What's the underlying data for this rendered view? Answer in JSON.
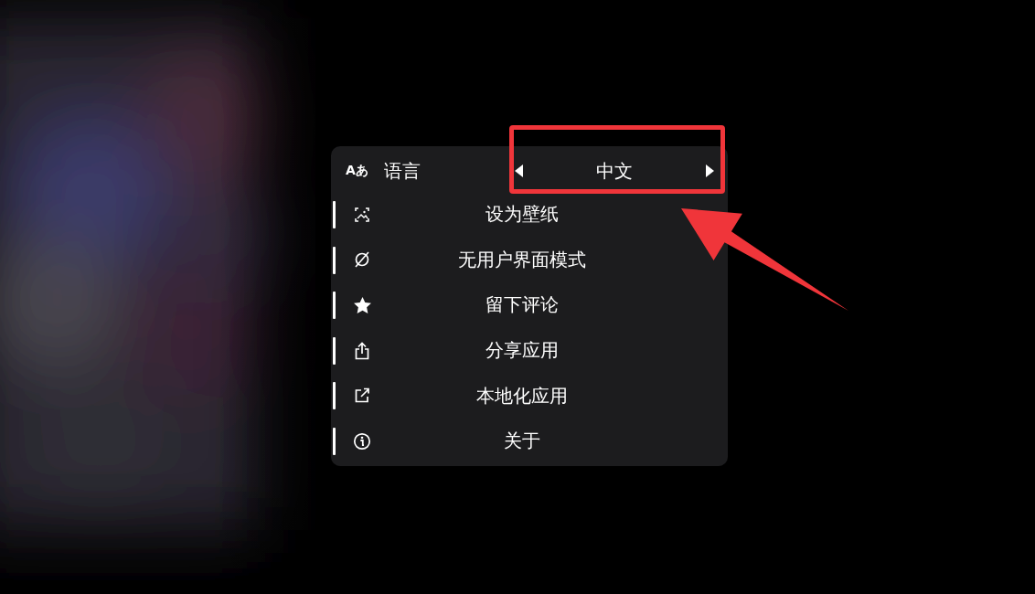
{
  "menu": {
    "language": {
      "icon_text": "Aあ",
      "label": "语言",
      "value": "中文"
    },
    "items": [
      {
        "label": "设为壁纸"
      },
      {
        "label": "无用户界面模式"
      },
      {
        "label": "留下评论"
      },
      {
        "label": "分享应用"
      },
      {
        "label": "本地化应用"
      },
      {
        "label": "关于"
      }
    ]
  },
  "highlight_frame": {
    "color": "#f0353a"
  },
  "pointer_arrow": {
    "color": "#f0353a"
  }
}
